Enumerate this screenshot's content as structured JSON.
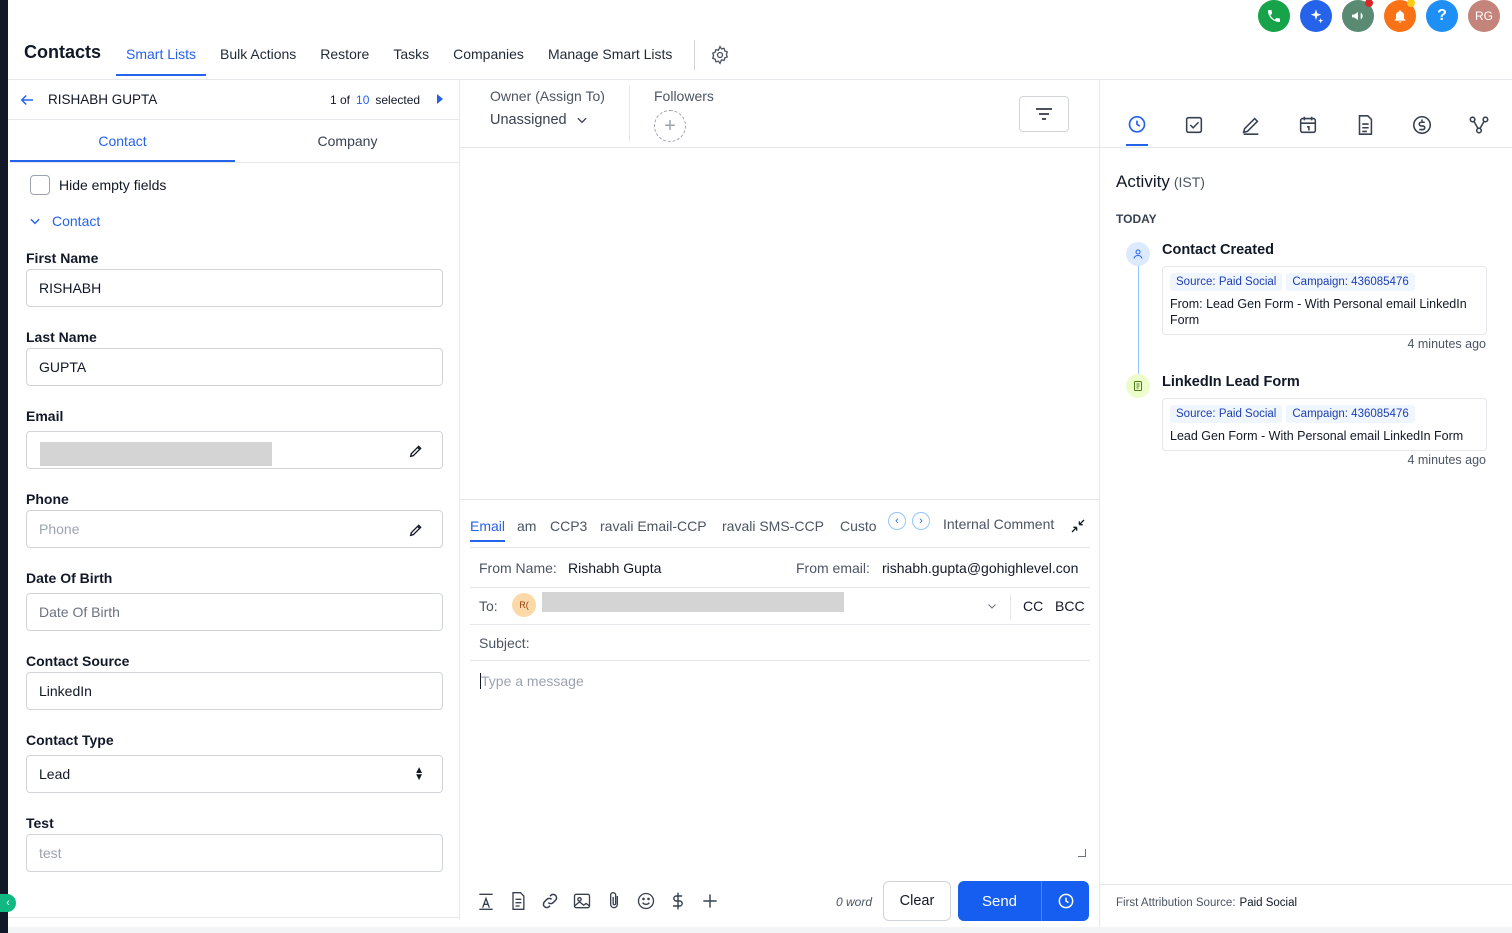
{
  "header": {
    "app_title": "Contacts",
    "tabs": [
      {
        "label": "Smart Lists",
        "active": true
      },
      {
        "label": "Bulk Actions"
      },
      {
        "label": "Restore"
      },
      {
        "label": "Tasks"
      },
      {
        "label": "Companies"
      },
      {
        "label": "Manage Smart Lists"
      }
    ],
    "action_icons": [
      {
        "icon": "phone-icon",
        "color": "#16a34a"
      },
      {
        "icon": "sparkle-icon",
        "color": "#2563eb"
      },
      {
        "icon": "megaphone-icon",
        "color": "#5b8a72",
        "badge": "#dc2626"
      },
      {
        "icon": "bell-icon",
        "color": "#f97316",
        "badge": "#facc15"
      },
      {
        "icon": "help-icon",
        "color": "#1d8ff5"
      }
    ],
    "avatar": "RG"
  },
  "record": {
    "name": "RISHABH GUPTA",
    "position_prefix": "1 of",
    "total": "10",
    "selected_label": "selected"
  },
  "left_tabs": [
    "Contact",
    "Company"
  ],
  "hide_empty_label": "Hide empty fields",
  "section_label": "Contact",
  "fields": {
    "first_name": {
      "label": "First Name",
      "value": "RISHABH"
    },
    "last_name": {
      "label": "Last Name",
      "value": "GUPTA"
    },
    "email": {
      "label": "Email"
    },
    "phone": {
      "label": "Phone",
      "placeholder": "Phone"
    },
    "dob": {
      "label": "Date Of Birth",
      "placeholder": "Date Of Birth"
    },
    "contact_source": {
      "label": "Contact Source",
      "value": "LinkedIn"
    },
    "contact_type": {
      "label": "Contact Type",
      "value": "Lead"
    },
    "test": {
      "label": "Test",
      "placeholder": "test"
    }
  },
  "owner": {
    "label": "Owner (Assign To)",
    "value": "Unassigned"
  },
  "followers": {
    "label": "Followers"
  },
  "composer": {
    "channels": [
      "Email",
      "am",
      "CCP3",
      "ravali Email-CCP",
      "ravali SMS-CCP",
      "Custo"
    ],
    "internal_comment": "Internal Comment",
    "from_name_label": "From Name:",
    "from_name": "Rishabh Gupta",
    "from_email_label": "From email:",
    "from_email": "rishabh.gupta@gohighlevel.con",
    "to_label": "To:",
    "to_initials": "R(",
    "cc": "CC",
    "bcc": "BCC",
    "subject_label": "Subject:",
    "message_placeholder": "Type a message",
    "word_count": "0 word",
    "clear": "Clear",
    "send": "Send"
  },
  "activity": {
    "title": "Activity",
    "timezone": "(IST)",
    "day": "TODAY",
    "items": [
      {
        "title": "Contact Created",
        "chips": [
          "Source: Paid Social",
          "Campaign: 436085476"
        ],
        "text": "From: Lead Gen Form - With Personal email LinkedIn Form",
        "time": "4 minutes ago"
      },
      {
        "title": "LinkedIn Lead Form",
        "chips": [
          "Source: Paid Social",
          "Campaign: 436085476"
        ],
        "text": "Lead Gen Form - With Personal email LinkedIn Form",
        "time": "4 minutes ago"
      }
    ],
    "attribution_label": "First Attribution Source:",
    "attribution_value": "Paid Social"
  },
  "accent": "#2563eb"
}
